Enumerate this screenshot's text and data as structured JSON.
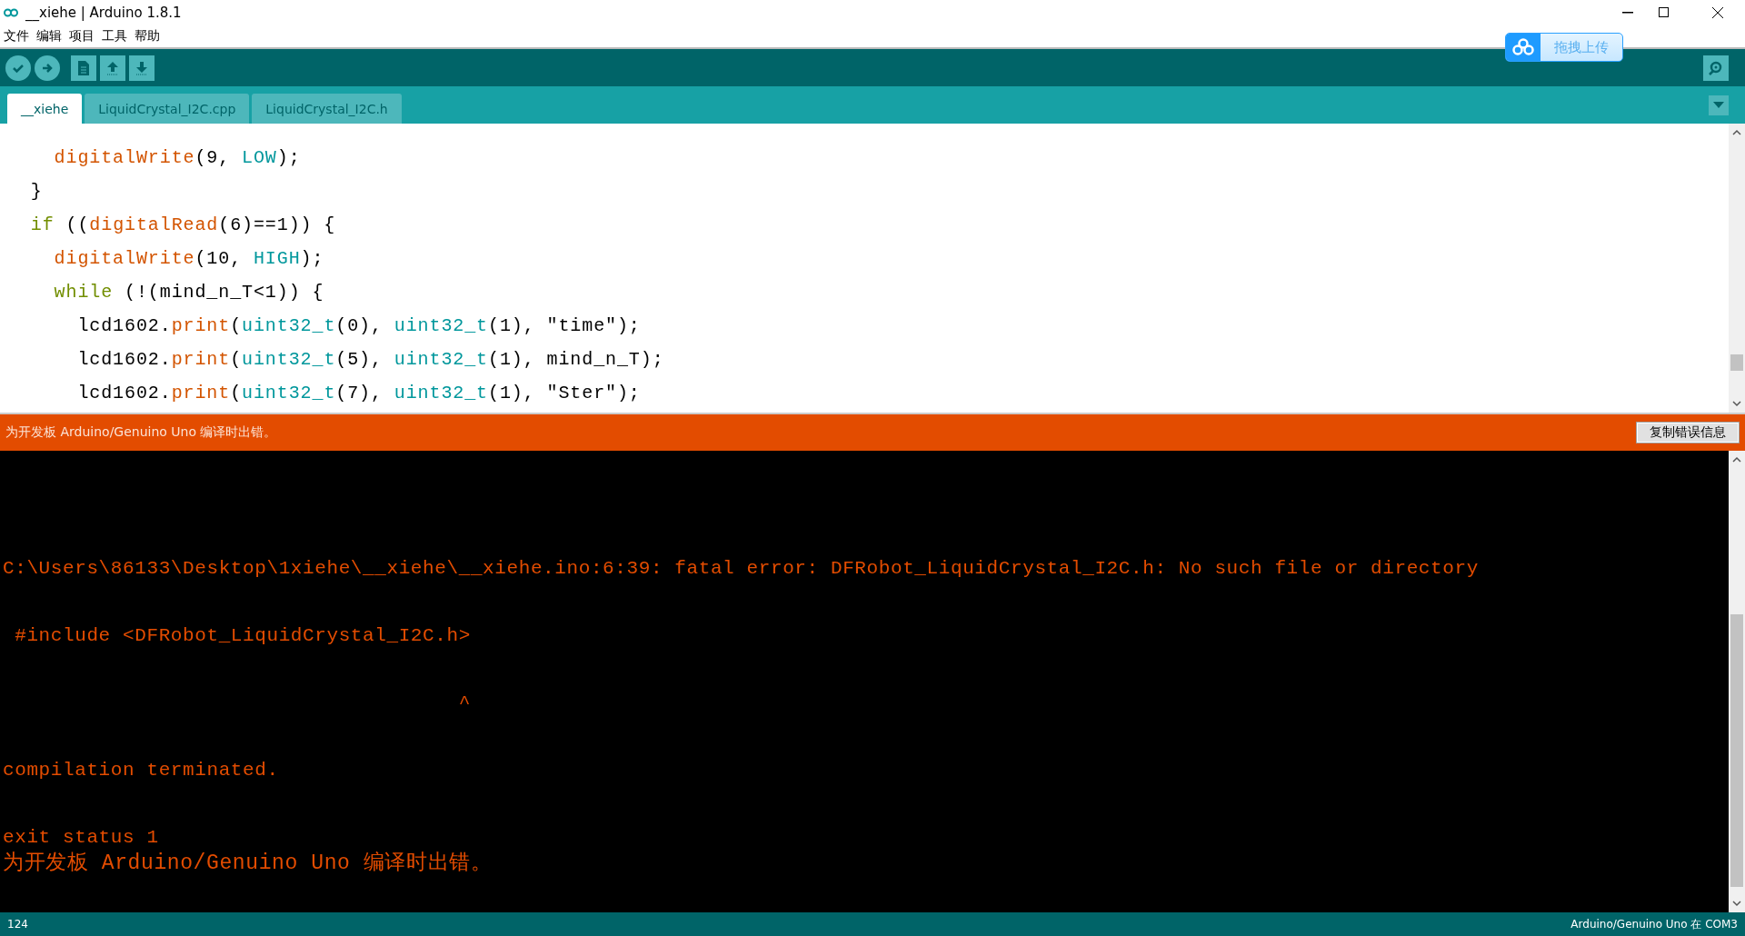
{
  "window": {
    "title": "__xiehe | Arduino 1.8.1"
  },
  "menu": [
    "文件",
    "编辑",
    "项目",
    "工具",
    "帮助"
  ],
  "toolbar": [
    {
      "kind": "verify"
    },
    {
      "kind": "upload"
    },
    {
      "kind": "new"
    },
    {
      "kind": "open"
    },
    {
      "kind": "save"
    }
  ],
  "upload_widget": {
    "label": "拖拽上传"
  },
  "tabs": [
    {
      "label": "__xiehe",
      "selected": true
    },
    {
      "label": "LiquidCrystal_I2C.cpp",
      "selected": false
    },
    {
      "label": "LiquidCrystal_I2C.h",
      "selected": false
    }
  ],
  "code": [
    [
      {
        "kind": "function",
        "text": "    digitalWrite"
      },
      {
        "kind": "plain",
        "text": "(9, "
      },
      {
        "kind": "constant",
        "text": "LOW"
      },
      {
        "kind": "plain",
        "text": ");"
      }
    ],
    [
      {
        "kind": "plain",
        "text": "  }"
      }
    ],
    [
      {
        "kind": "keyword",
        "text": "  if"
      },
      {
        "kind": "plain",
        "text": " (("
      },
      {
        "kind": "function",
        "text": "digitalRead"
      },
      {
        "kind": "plain",
        "text": "(6)==1)) {"
      }
    ],
    [
      {
        "kind": "function",
        "text": "    digitalWrite"
      },
      {
        "kind": "plain",
        "text": "(10, "
      },
      {
        "kind": "constant",
        "text": "HIGH"
      },
      {
        "kind": "plain",
        "text": ");"
      }
    ],
    [
      {
        "kind": "keyword",
        "text": "    while"
      },
      {
        "kind": "plain",
        "text": " (!(mind_n_T<1)) {"
      }
    ],
    [
      {
        "kind": "plain",
        "text": "      lcd1602."
      },
      {
        "kind": "function",
        "text": "print"
      },
      {
        "kind": "plain",
        "text": "("
      },
      {
        "kind": "constant",
        "text": "uint32_t"
      },
      {
        "kind": "plain",
        "text": "(0), "
      },
      {
        "kind": "constant",
        "text": "uint32_t"
      },
      {
        "kind": "plain",
        "text": "(1), \"time\");"
      }
    ],
    [
      {
        "kind": "plain",
        "text": "      lcd1602."
      },
      {
        "kind": "function",
        "text": "print"
      },
      {
        "kind": "plain",
        "text": "("
      },
      {
        "kind": "constant",
        "text": "uint32_t"
      },
      {
        "kind": "plain",
        "text": "(5), "
      },
      {
        "kind": "constant",
        "text": "uint32_t"
      },
      {
        "kind": "plain",
        "text": "(1), mind_n_T);"
      }
    ],
    [
      {
        "kind": "plain",
        "text": "      lcd1602."
      },
      {
        "kind": "function",
        "text": "print"
      },
      {
        "kind": "plain",
        "text": "("
      },
      {
        "kind": "constant",
        "text": "uint32_t"
      },
      {
        "kind": "plain",
        "text": "(7), "
      },
      {
        "kind": "constant",
        "text": "uint32_t"
      },
      {
        "kind": "plain",
        "text": "(1), \"Ster\");"
      }
    ]
  ],
  "error_bar": {
    "message": "为开发板 Arduino/Genuino Uno 编译时出错。",
    "button": "复制错误信息"
  },
  "console": [
    {
      "kind": "blank"
    },
    {
      "kind": "blank"
    },
    {
      "kind": "text",
      "text": "C:\\Users\\86133\\Desktop\\1xiehe\\__xiehe\\__xiehe.ino:6:39: fatal error: DFRobot_LiquidCrystal_I2C.h: No such file or directory"
    },
    {
      "kind": "blank"
    },
    {
      "kind": "text",
      "text": " #include <DFRobot_LiquidCrystal_I2C.h>"
    },
    {
      "kind": "blank"
    },
    {
      "kind": "text",
      "text": "                                      ^"
    },
    {
      "kind": "blank"
    },
    {
      "kind": "text",
      "text": "compilation terminated."
    },
    {
      "kind": "blank"
    },
    {
      "kind": "text",
      "text": "exit status 1"
    },
    {
      "kind": "text",
      "text": "为开发板 Arduino/Genuino Uno 编译时出错。"
    }
  ],
  "status_bar": {
    "line": "124",
    "board": "Arduino/Genuino Uno 在 COM3"
  }
}
